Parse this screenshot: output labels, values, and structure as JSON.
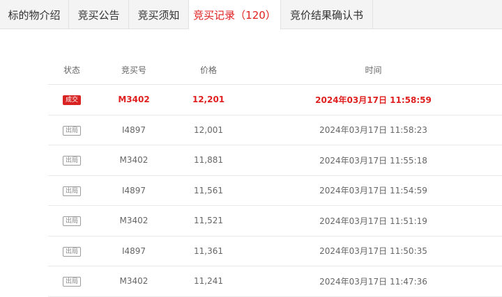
{
  "tabs": [
    {
      "label": "标的物介绍"
    },
    {
      "label": "竞买公告"
    },
    {
      "label": "竞买须知"
    },
    {
      "label": "竞买记录（120）"
    },
    {
      "label": "竞价结果确认书"
    }
  ],
  "active_tab_index": 3,
  "table": {
    "headers": {
      "status": "状态",
      "bid_no": "竞买号",
      "price": "价格",
      "time": "时间"
    },
    "rows": [
      {
        "status": "成交",
        "bid_no": "M3402",
        "price": "12,201",
        "time": "2024年03月17日 11:58:59"
      },
      {
        "status": "出局",
        "bid_no": "I4897",
        "price": "12,001",
        "time": "2024年03月17日 11:58:23"
      },
      {
        "status": "出局",
        "bid_no": "M3402",
        "price": "11,881",
        "time": "2024年03月17日 11:55:18"
      },
      {
        "status": "出局",
        "bid_no": "I4897",
        "price": "11,561",
        "time": "2024年03月17日 11:54:59"
      },
      {
        "status": "出局",
        "bid_no": "M3402",
        "price": "11,521",
        "time": "2024年03月17日 11:51:19"
      },
      {
        "status": "出局",
        "bid_no": "I4897",
        "price": "11,361",
        "time": "2024年03月17日 11:50:35"
      },
      {
        "status": "出局",
        "bid_no": "M3402",
        "price": "11,241",
        "time": "2024年03月17日 11:47:36"
      }
    ]
  },
  "colors": {
    "accent": "#e02020",
    "deal_badge": "#d92323",
    "text_muted": "#666666",
    "tab_bg": "#f4f4f4"
  }
}
